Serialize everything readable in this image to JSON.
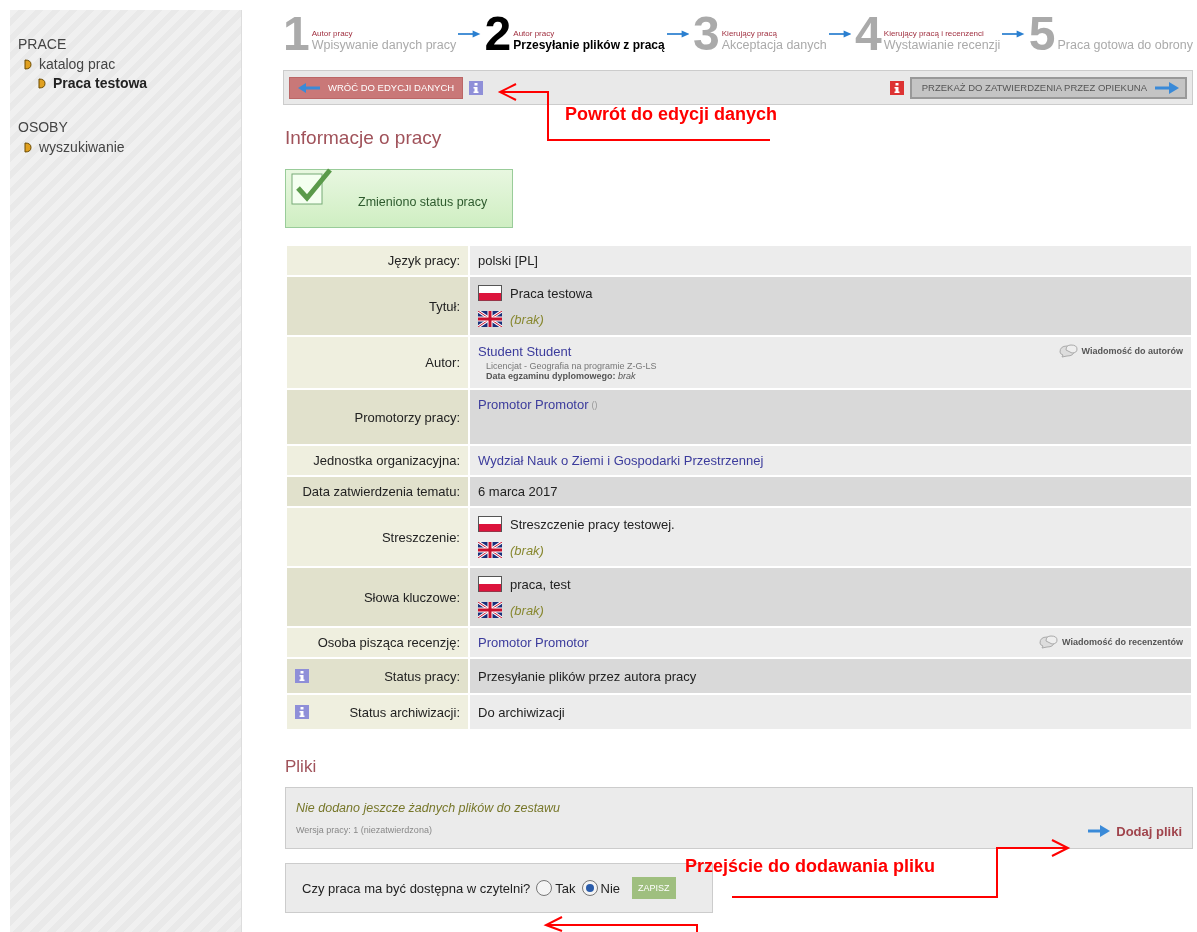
{
  "sidebar": {
    "sections": [
      {
        "title": "PRACE",
        "items": [
          {
            "label": "katalog prac",
            "selected": false,
            "children": [
              {
                "label": "Praca testowa",
                "selected": true
              }
            ]
          }
        ]
      },
      {
        "title": "OSOBY",
        "items": [
          {
            "label": "wyszukiwanie",
            "selected": false
          }
        ]
      }
    ]
  },
  "steps": [
    {
      "number": "1",
      "role": "Autor pracy",
      "label": "Wpisywanie danych pracy",
      "selected": false
    },
    {
      "number": "2",
      "role": "Autor pracy",
      "label": "Przesyłanie plików z pracą",
      "selected": true
    },
    {
      "number": "3",
      "role": "Kierujący pracą",
      "label": "Akceptacja danych",
      "selected": false
    },
    {
      "number": "4",
      "role": "Kierujący pracą i recenzenci",
      "label": "Wystawianie recenzji",
      "selected": false
    },
    {
      "number": "5",
      "label": "Praca gotowa do obrony",
      "selected": false
    }
  ],
  "toolbar": {
    "back_button": "WRÓĆ DO EDYCJI DANYCH",
    "next_button": "PRZEKAŻ DO ZATWIERDZENIA PRZEZ OPIEKUNA"
  },
  "section_title": "Informacje o pracy",
  "status_message": "Zmieniono status pracy",
  "details": [
    {
      "label": "Język pracy:",
      "kind": "text",
      "value": "polski [PL]"
    },
    {
      "label": "Tytuł:",
      "kind": "multilang",
      "values": [
        {
          "kind": "polish",
          "text": "Praca testowa",
          "missing": false
        },
        {
          "kind": "english",
          "text": "(brak)",
          "missing": true
        }
      ]
    },
    {
      "label": "Autor:",
      "kind": "person",
      "value": "Student Student",
      "detail": "Licencjat - Geografia na programie Z-G-LS",
      "exam_label": "Data egzaminu dyplomowego:",
      "exam_value": "brak",
      "action": "Wiadomość do autorów"
    },
    {
      "label": "Promotorzy pracy:",
      "kind": "supervisor",
      "value": "Promotor Promotor",
      "suffix": "()"
    },
    {
      "label": "Jednostka organizacyjna:",
      "kind": "link",
      "value": "Wydział Nauk o Ziemi i Gospodarki Przestrzennej"
    },
    {
      "label": "Data zatwierdzenia tematu:",
      "kind": "text",
      "value": "6 marca 2017"
    },
    {
      "label": "Streszczenie:",
      "kind": "multilang",
      "values": [
        {
          "kind": "polish",
          "text": "Streszczenie pracy testowej.",
          "missing": false
        },
        {
          "kind": "english",
          "text": "(brak)",
          "missing": true
        }
      ]
    },
    {
      "label": "Słowa kluczowe:",
      "kind": "multilang",
      "values": [
        {
          "kind": "polish",
          "text": "praca, test",
          "missing": false
        },
        {
          "kind": "english",
          "text": "(brak)",
          "missing": true
        }
      ]
    },
    {
      "label": "Osoba pisząca recenzję:",
      "kind": "person",
      "value": "Promotor Promotor",
      "action": "Wiadomość do recenzentów"
    },
    {
      "label": "Status pracy:",
      "kind": "text",
      "value": "Przesyłanie plików przez autora pracy",
      "info": true
    },
    {
      "label": "Status archiwizacji:",
      "kind": "text",
      "value": "Do archiwizacji",
      "info": true
    }
  ],
  "files": {
    "title": "Pliki",
    "empty_message": "Nie dodano jeszcze żadnych plików do zestawu",
    "version": "Wersja pracy: 1 (niezatwierdzona)",
    "add_button": "Dodaj pliki"
  },
  "reading_room": {
    "question": "Czy praca ma być dostępna w czytelni?",
    "options": [
      {
        "label": "Tak",
        "selected": false
      },
      {
        "label": "Nie",
        "selected": true
      }
    ],
    "save_button": "ZAPISZ"
  },
  "callouts": [
    {
      "text": "Powrót do edycji danych"
    },
    {
      "text": "Przejście do dodawania pliku"
    }
  ]
}
